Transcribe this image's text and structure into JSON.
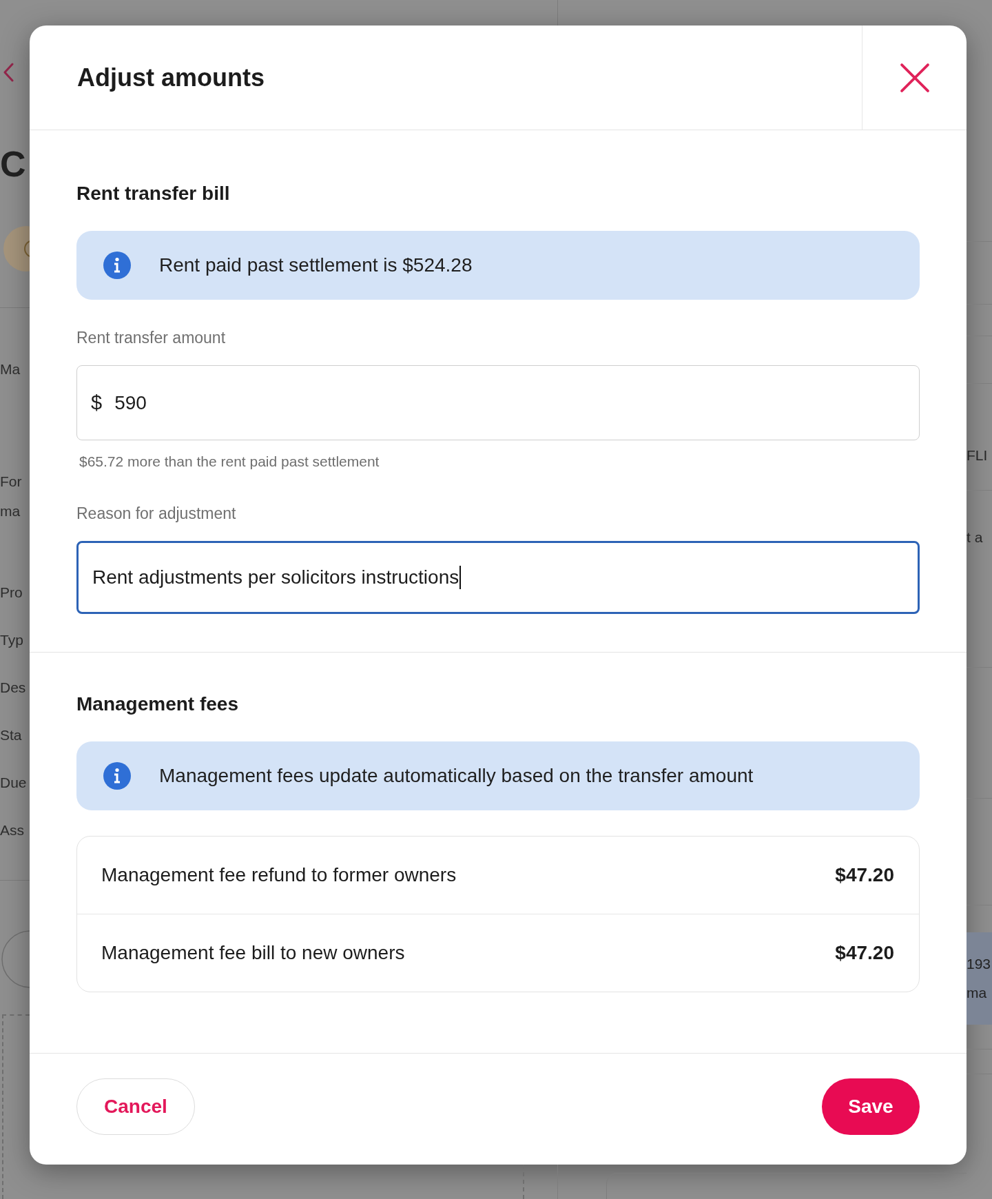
{
  "background": {
    "page_title": "C",
    "left_labels": [
      {
        "lines": [
          "Ma"
        ]
      },
      {
        "lines": [
          "For",
          "ma"
        ]
      },
      {
        "lines": [
          "Pro"
        ]
      },
      {
        "lines": [
          "Typ"
        ]
      },
      {
        "lines": [
          "Des"
        ]
      },
      {
        "lines": [
          "Sta"
        ]
      },
      {
        "lines": [
          "Due"
        ]
      },
      {
        "lines": [
          "Ass"
        ]
      }
    ],
    "right_texts": [
      "FLI",
      "t a"
    ],
    "right_highlight_lines": [
      "193",
      "ma"
    ]
  },
  "dialog": {
    "title": "Adjust amounts",
    "sections": [
      {
        "heading": "Rent transfer bill",
        "notice": "Rent paid past settlement is $524.28",
        "fields": [
          {
            "label": "Rent transfer amount",
            "prefix": "$",
            "value": "590",
            "helper": "$65.72 more than the rent paid past settlement",
            "focused": false
          },
          {
            "label": "Reason for adjustment",
            "value": "Rent adjustments per solicitors instructions",
            "focused": true
          }
        ]
      },
      {
        "heading": "Management fees",
        "notice": "Management fees update automatically based on the transfer amount",
        "items": [
          {
            "label": "Management fee refund to former owners",
            "amount": "$47.20"
          },
          {
            "label": "Management fee bill to new owners",
            "amount": "$47.20"
          }
        ]
      }
    ],
    "buttons": [
      {
        "label": "Cancel",
        "kind": "secondary"
      },
      {
        "label": "Save",
        "kind": "primary"
      }
    ]
  }
}
